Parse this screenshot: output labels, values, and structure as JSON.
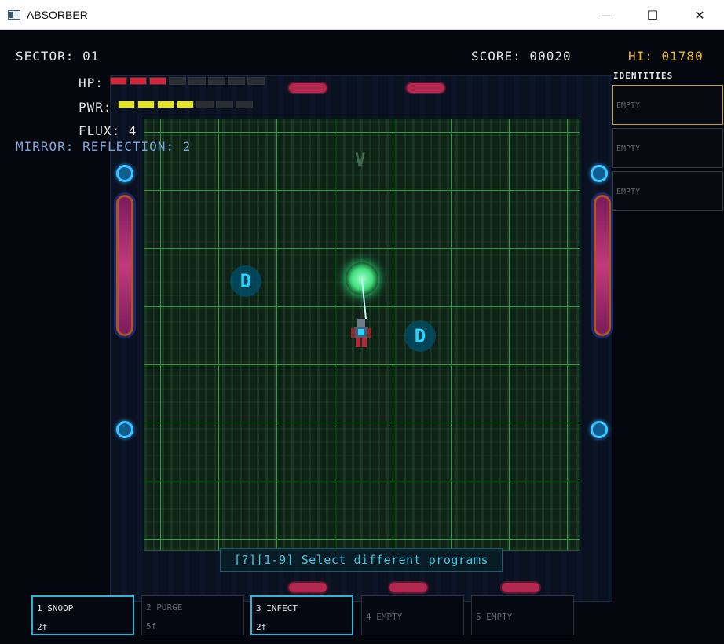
{
  "window": {
    "title": "ABSORBER",
    "minimize_glyph": "—",
    "maximize_glyph": "☐",
    "close_glyph": "✕"
  },
  "hud": {
    "sector": "SECTOR: 01",
    "score": "SCORE: 00020",
    "hi": "HI: 01780",
    "hp_label": "HP:",
    "pwr_label": "PWR:",
    "flux": "FLUX: 4",
    "mirror": "MIRROR: REFLECTION: 2",
    "hp": {
      "filled": 3,
      "total": 8,
      "color": "#d8233a"
    },
    "pwr": {
      "filled": 4,
      "total": 7,
      "color": "#e4e41e"
    }
  },
  "arena": {
    "enemy_label": "D",
    "marker": "V",
    "hint": "[?][1-9] Select different programs"
  },
  "identities": {
    "title": "IDENTITIES",
    "slots": [
      "EMPTY",
      "EMPTY",
      "EMPTY"
    ]
  },
  "programs": [
    {
      "name": "1 SNOOP",
      "cost": "2f"
    },
    {
      "name": "2 PURGE",
      "cost": "5f"
    },
    {
      "name": "3 INFECT",
      "cost": "2f"
    },
    {
      "name": "4 EMPTY",
      "cost": ""
    },
    {
      "name": "5 EMPTY",
      "cost": ""
    }
  ]
}
